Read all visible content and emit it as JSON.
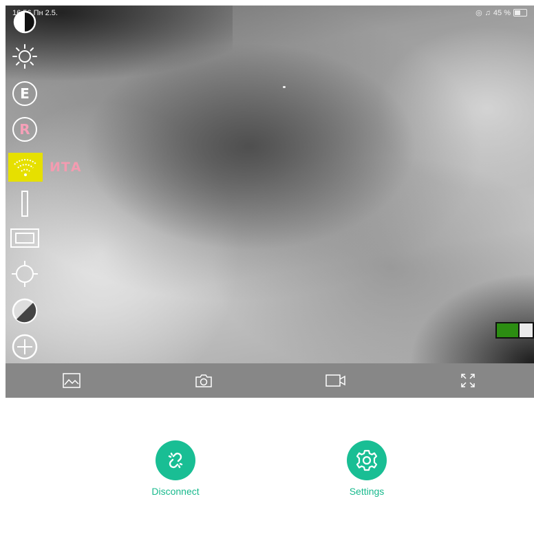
{
  "status_bar": {
    "time": "16:56",
    "date": "Пн 2.5.",
    "battery_text": "45 %"
  },
  "overlay": {
    "tools": [
      {
        "icon": "contrast-half-icon"
      },
      {
        "icon": "brightness-sun-icon"
      },
      {
        "icon": "letter-e-icon",
        "label": "E"
      },
      {
        "icon": "letter-r-icon",
        "label": "R"
      },
      {
        "icon": "wifi-icon"
      },
      {
        "icon": "vertical-bar-icon"
      },
      {
        "icon": "rectangle-frame-icon"
      },
      {
        "icon": "crosshair-target-icon"
      },
      {
        "icon": "diagonal-contrast-icon"
      },
      {
        "icon": "zoom-plus-icon"
      }
    ],
    "wifi_status_text": "ИТА",
    "level_indicator": {
      "filled_fraction": 0.6,
      "color": "#2c8d12"
    }
  },
  "toolbar": {
    "buttons": [
      {
        "icon": "gallery-image-icon"
      },
      {
        "icon": "camera-icon"
      },
      {
        "icon": "video-record-icon"
      },
      {
        "icon": "fullscreen-expand-icon"
      }
    ],
    "background": "#878787"
  },
  "actions": {
    "disconnect": {
      "label": "Disconnect",
      "icon": "broken-link-icon"
    },
    "settings": {
      "label": "Settings",
      "icon": "gear-icon"
    },
    "accent_color": "#19be94"
  }
}
